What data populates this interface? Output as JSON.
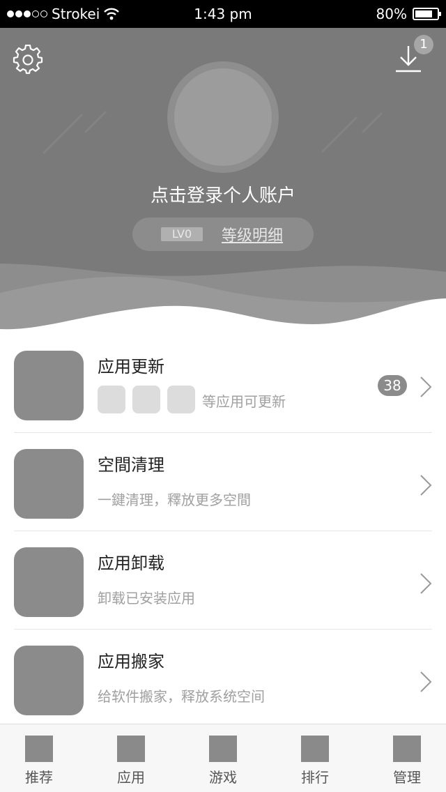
{
  "status_bar": {
    "carrier": "Strokei",
    "time": "1:43 pm",
    "battery": "80%",
    "battery_level": 0.8
  },
  "header": {
    "download_badge": "1",
    "login_text": "点击登录个人账户",
    "level_badge": "LV0",
    "level_link": "等级明细"
  },
  "list": [
    {
      "title": "应用更新",
      "subtitle": "等应用可更新",
      "badge": "38"
    },
    {
      "title": "空間清理",
      "subtitle": "一鍵清理，釋放更多空間"
    },
    {
      "title": "应用卸载",
      "subtitle": "卸载已安装应用"
    },
    {
      "title": "应用搬家",
      "subtitle": "给软件搬家，释放系统空间"
    }
  ],
  "tabs": [
    {
      "label": "推荐"
    },
    {
      "label": "应用"
    },
    {
      "label": "游戏"
    },
    {
      "label": "排行"
    },
    {
      "label": "管理"
    }
  ]
}
